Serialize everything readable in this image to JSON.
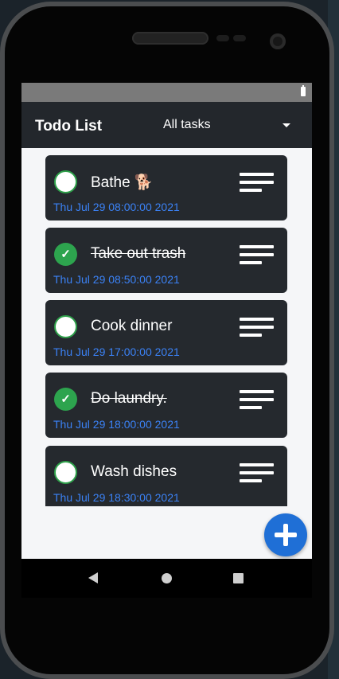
{
  "app": {
    "title": "Todo List"
  },
  "filter": {
    "selected": "All tasks"
  },
  "tasks": [
    {
      "title": "Bathe 🐕",
      "date": "Thu Jul 29 08:00:00 2021",
      "completed": false
    },
    {
      "title": "Take out trash",
      "date": "Thu Jul 29 08:50:00 2021",
      "completed": true
    },
    {
      "title": "Cook dinner",
      "date": "Thu Jul 29 17:00:00 2021",
      "completed": false
    },
    {
      "title": "Do laundry.",
      "date": "Thu Jul 29 18:00:00 2021",
      "completed": true
    },
    {
      "title": "Wash dishes",
      "date": "Thu Jul 29 18:30:00 2021",
      "completed": false
    }
  ],
  "icons": {
    "complete": "check-icon",
    "menu": "menu-icon",
    "add": "plus-icon",
    "battery": "battery-icon"
  },
  "colors": {
    "accent": "#1f6fd6",
    "complete": "#2da44e",
    "date": "#3b82f6",
    "card": "#25292e",
    "appbar": "#23272c"
  }
}
